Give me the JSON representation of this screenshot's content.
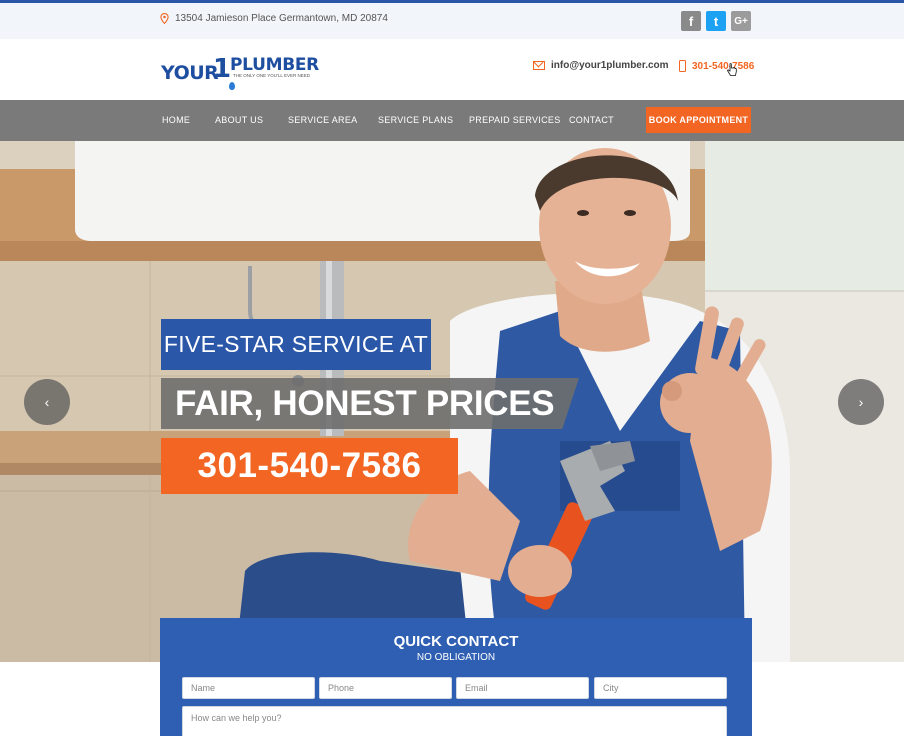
{
  "topbar": {
    "address": "13504 Jamieson Place Germantown, MD 20874",
    "social": [
      "f",
      "t",
      "G+"
    ]
  },
  "header": {
    "logo": {
      "word1": "YOUR",
      "number": "1",
      "word2": "PLUMBER",
      "tagline": "THE ONLY ONE YOU'LL EVER NEED"
    },
    "email": "info@your1plumber.com",
    "phone": "301-540-7586"
  },
  "nav": {
    "items": [
      "HOME",
      "ABOUT US",
      "SERVICE AREA",
      "SERVICE PLANS",
      "PREPAID SERVICES",
      "CONTACT"
    ],
    "cta": "BOOK APPOINTMENT"
  },
  "hero": {
    "line1": "FIVE-STAR SERVICE AT",
    "line2": "FAIR, HONEST PRICES",
    "line3": "301-540-7586",
    "prev": "‹",
    "next": "›"
  },
  "quick_contact": {
    "title": "QUICK CONTACT",
    "subtitle": "NO OBLIGATION",
    "name_placeholder": "Name",
    "phone_placeholder": "Phone",
    "email_placeholder": "Email",
    "city_placeholder": "City",
    "message_placeholder": "How can we help you?"
  },
  "colors": {
    "brand_blue": "#2a57a8",
    "brand_orange": "#f26522",
    "nav_gray": "#7a7a7a"
  }
}
